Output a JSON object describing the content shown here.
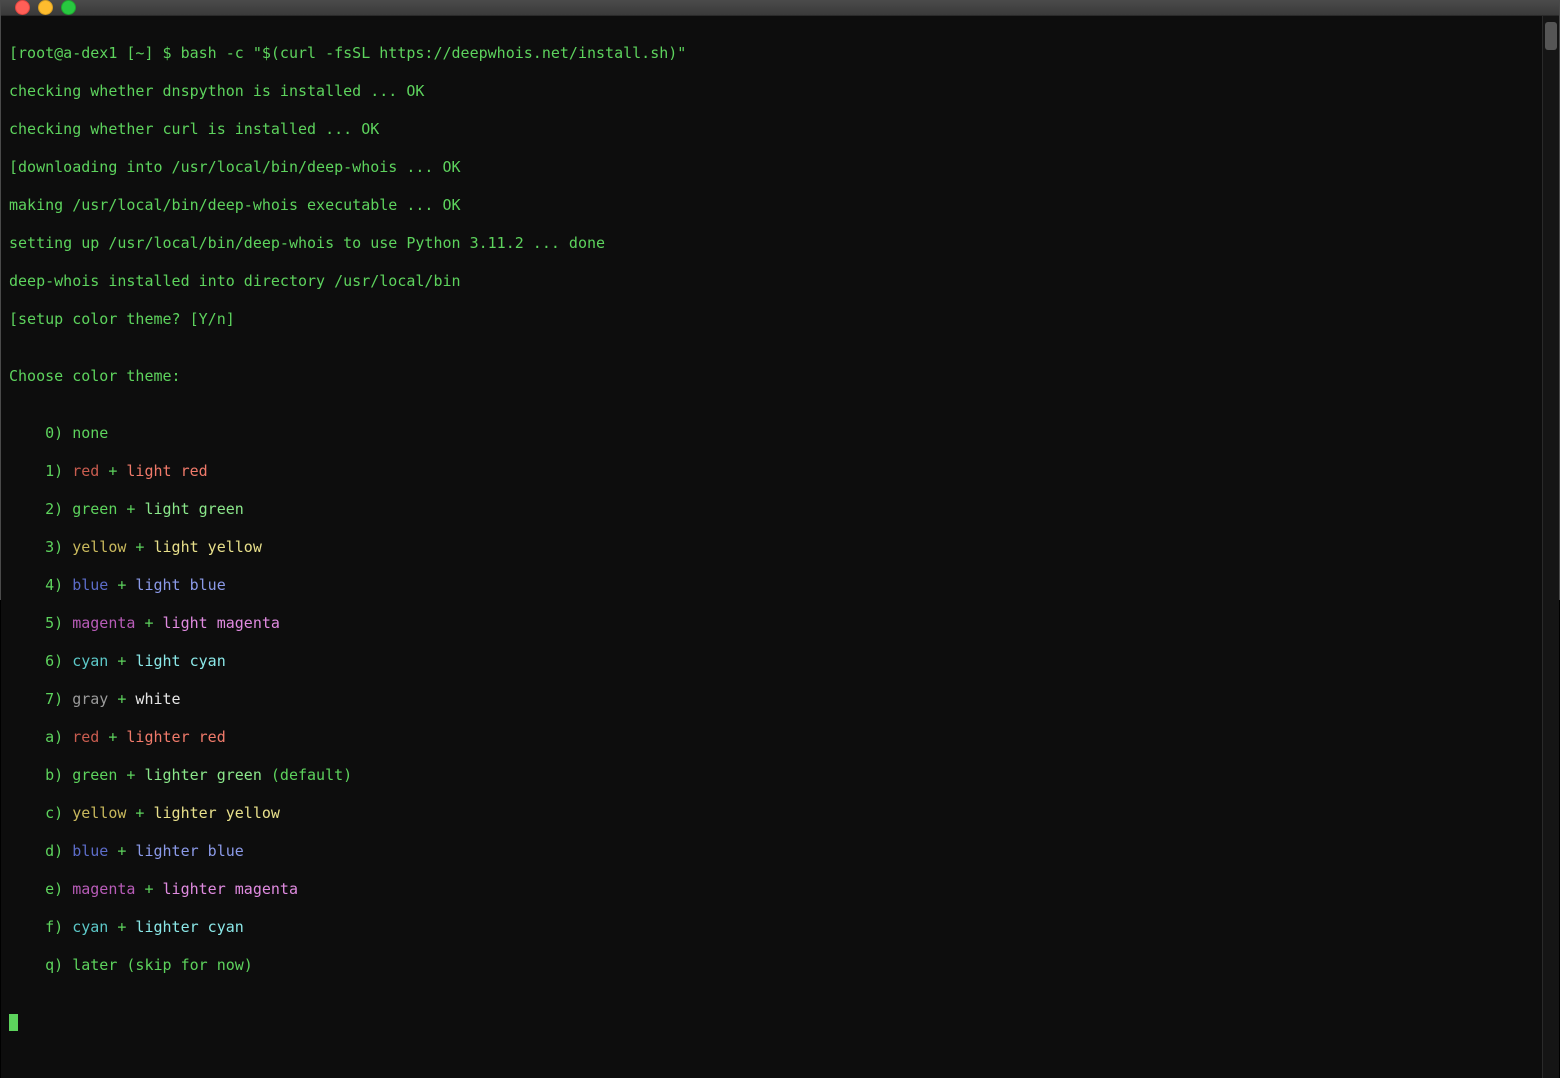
{
  "prompt": {
    "bracket_open": "[",
    "user_host": "root@a-dex1",
    "cwd": " [~] $ ",
    "command": "bash -c \"$(curl -fsSL https://deepwhois.net/install.sh)\"",
    "bracket_close": ""
  },
  "output": {
    "l1": "checking whether dnspython is installed ... OK",
    "l2": "checking whether curl is installed ... OK",
    "l3_open": "[",
    "l3": "downloading into /usr/local/bin/deep-whois ... OK",
    "l4": "making /usr/local/bin/deep-whois executable ... OK",
    "l5": "setting up /usr/local/bin/deep-whois to use Python 3.11.2 ... done",
    "l6": "deep-whois installed into directory /usr/local/bin",
    "l7_open": "[",
    "l7": "setup color theme? [Y/n]",
    "blank": "",
    "heading": "Choose color theme:"
  },
  "opts": {
    "o0": {
      "key": "0) ",
      "a": "none"
    },
    "o1": {
      "key": "1) ",
      "a": "red",
      "plus": " + ",
      "b": "light red"
    },
    "o2": {
      "key": "2) ",
      "a": "green",
      "plus": " + ",
      "b": "light green"
    },
    "o3": {
      "key": "3) ",
      "a": "yellow",
      "plus": " + ",
      "b": "light yellow"
    },
    "o4": {
      "key": "4) ",
      "a": "blue",
      "plus": " + ",
      "b": "light blue"
    },
    "o5": {
      "key": "5) ",
      "a": "magenta",
      "plus": " + ",
      "b": "light magenta"
    },
    "o6": {
      "key": "6) ",
      "a": "cyan",
      "plus": " + ",
      "b": "light cyan"
    },
    "o7": {
      "key": "7) ",
      "a": "gray",
      "plus": " + ",
      "b": "white"
    },
    "oa": {
      "key": "a) ",
      "a": "red",
      "plus": " + ",
      "b": "lighter red"
    },
    "ob": {
      "key": "b) ",
      "a": "green",
      "plus": " + ",
      "b": "lighter green",
      "suffix": " (default)"
    },
    "oc": {
      "key": "c) ",
      "a": "yellow",
      "plus": " + ",
      "b": "lighter yellow"
    },
    "od": {
      "key": "d) ",
      "a": "blue",
      "plus": " + ",
      "b": "lighter blue"
    },
    "oe": {
      "key": "e) ",
      "a": "magenta",
      "plus": " + ",
      "b": "lighter magenta"
    },
    "of": {
      "key": "f) ",
      "a": "cyan",
      "plus": " + ",
      "b": "lighter cyan"
    },
    "oq": {
      "key": "q) ",
      "a": "later (skip for now)"
    }
  }
}
